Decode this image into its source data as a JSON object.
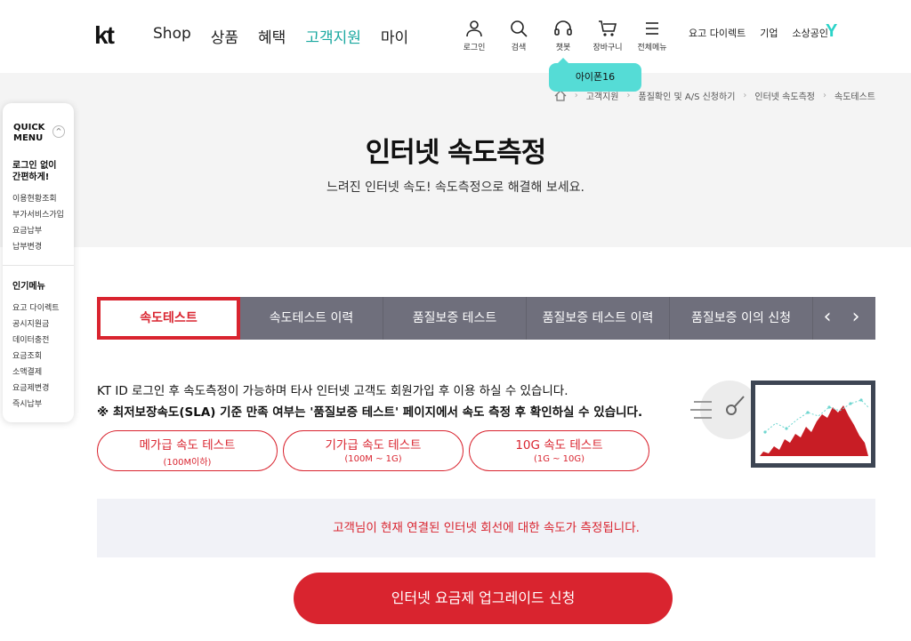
{
  "header": {
    "logo": "kt",
    "nav": [
      "Shop",
      "상품",
      "혜택",
      "고객지원",
      "마이"
    ],
    "utility": [
      {
        "label": "로그인",
        "icon": "user-icon"
      },
      {
        "label": "검색",
        "icon": "search-icon"
      },
      {
        "label": "챗봇",
        "icon": "headset-icon"
      },
      {
        "label": "장바구니",
        "icon": "cart-icon"
      },
      {
        "label": "전체메뉴",
        "icon": "menu-icon"
      }
    ],
    "top_links": [
      "요고 다이렉트",
      "기업",
      "소상공인"
    ],
    "y_logo": "Y",
    "chatbot_bubble": "아이폰16"
  },
  "breadcrumb": [
    "고객지원",
    "품질확인 및 A/S 신청하기",
    "인터넷 속도측정",
    "속도테스트"
  ],
  "hero": {
    "title": "인터넷 속도측정",
    "subtitle": "느려진 인터넷 속도! 속도측정으로 해결해 보세요."
  },
  "quick_menu": {
    "title_line1": "QUICK",
    "title_line2": "MENU",
    "toggle": "^",
    "section1_line1": "로그인 없이",
    "section1_line2": "간편하게!",
    "section1_items": [
      "이용현황조회",
      "부가서비스가입",
      "요금납부",
      "납부변경"
    ],
    "section2_title": "인기메뉴",
    "section2_items": [
      "요고 다이렉트",
      "공시지원금",
      "데이터충전",
      "요금조회",
      "소액결제",
      "요금제변경",
      "즉시납부"
    ]
  },
  "tabs": [
    "속도테스트",
    "속도테스트 이력",
    "품질보증 테스트",
    "품질보증 테스트 이력",
    "품질보증 이의 신청"
  ],
  "tab_prev": "‹",
  "tab_next": "›",
  "notice": "KT ID 로그인 후 속도측정이 가능하며 타사 인터넷 고객도 회원가입 후 이용 하실 수 있습니다.",
  "notice_bold": "※ 최저보장속도(SLA) 기준 만족 여부는 '품질보증 테스트' 페이지에서 속도 측정 후 확인하실 수 있습니다.",
  "test_buttons": [
    {
      "label": "메가급 속도 테스트",
      "sub": "(100M이하)"
    },
    {
      "label": "기가급 속도 테스트",
      "sub": "(100M ~ 1G)"
    },
    {
      "label": "10G 속도 테스트",
      "sub": "(1G ~ 10G)"
    }
  ],
  "info_text": "고객님이 현재 연결된 인터넷 회선에 대한 속도가 측정됩니다.",
  "cta": "인터넷 요금제 업그레이드 신청",
  "colors": {
    "brand_red": "#d9242f",
    "teal": "#1aa8a0",
    "tab_bg": "#6f6f7c",
    "hero_bg": "#f4f4f4"
  }
}
